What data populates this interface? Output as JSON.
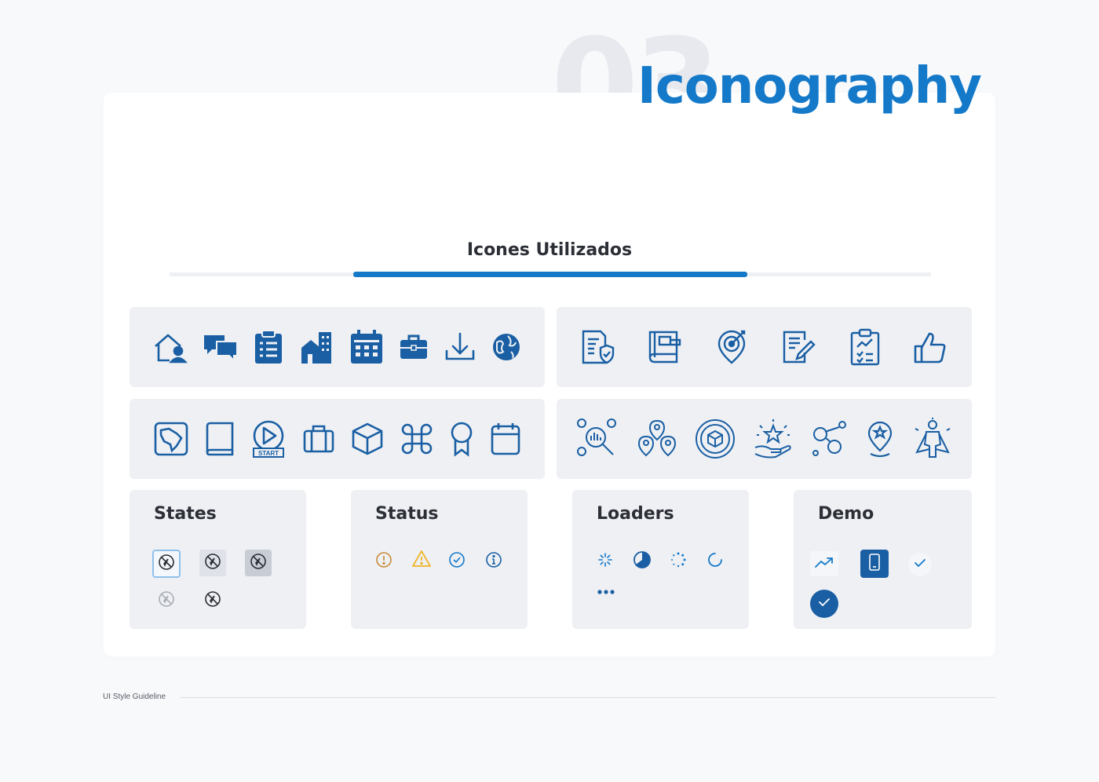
{
  "header": {
    "section_number": "03",
    "title": "Iconography"
  },
  "section": {
    "title": "Icones Utilizados"
  },
  "icons": {
    "row1_left": [
      "home-user-icon",
      "chat-bubbles-icon",
      "clipboard-list-icon",
      "buildings-icon",
      "calendar-icon",
      "briefcase-icon",
      "download-icon",
      "globe-icon"
    ],
    "row1_right": [
      "document-shield-icon",
      "book-icon",
      "location-target-icon",
      "note-edit-icon",
      "clipboard-chart-icon",
      "thumbs-up-icon"
    ],
    "row2_left": [
      "map-brazil-icon",
      "book-outline-icon",
      "start-play-icon",
      "luggage-icon",
      "cube-icon",
      "command-icon",
      "award-ribbon-icon",
      "calendar-outline-icon"
    ],
    "row2_left_start_text": "START",
    "row2_right": [
      "people-search-icon",
      "team-network-icon",
      "globe-cube-icon",
      "star-hand-icon",
      "people-connect-icon",
      "location-star-icon",
      "superhero-icon"
    ]
  },
  "states": {
    "title": "States"
  },
  "status": {
    "title": "Status"
  },
  "loaders": {
    "title": "Loaders"
  },
  "demo": {
    "title": "Demo"
  },
  "colors": {
    "brand": "#1479c9",
    "icon_dark": "#1a5fa3",
    "warning": "#f0b429",
    "error": "#c98b3a"
  },
  "footer": {
    "label": "UI Style Guideline"
  }
}
